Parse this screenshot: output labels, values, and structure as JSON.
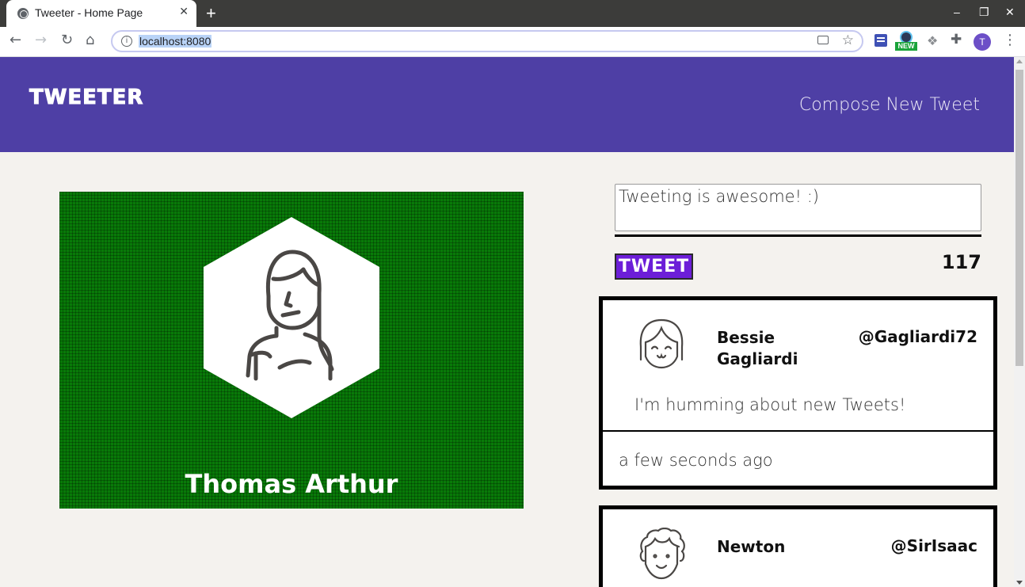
{
  "browser": {
    "tab_title": "Tweeter - Home Page",
    "tab_close": "✕",
    "new_tab": "+",
    "url": "localhost:8080",
    "profile_initial": "T",
    "extension_badge": "NEW",
    "window_controls": {
      "minimize": "–",
      "restore": "❐",
      "close": "✕"
    },
    "nav": {
      "back": "←",
      "forward": "→",
      "reload": "↻",
      "home": "⌂"
    }
  },
  "header": {
    "brand": "TWEETER",
    "compose_link": "Compose New Tweet"
  },
  "profile": {
    "name": "Thomas Arthur",
    "background_color": "#087a08"
  },
  "composer": {
    "text": "Tweeting is awesome! :)",
    "submit_label": "TWEET",
    "char_counter": "117"
  },
  "tweets": [
    {
      "name": "Bessie Gagliardi",
      "handle": "@Gagliardi72",
      "body": "I'm humming about new Tweets!",
      "time": "a few seconds ago",
      "avatar_icon": "girl-avatar-icon"
    },
    {
      "name": "Newton",
      "handle": "@SirIsaac",
      "body": "",
      "time": "",
      "avatar_icon": "curly-hair-avatar-icon"
    }
  ],
  "colors": {
    "nav_bg": "#4e3fa5",
    "tweet_button": "#6c1ed8",
    "page_bg": "#f4f2ee"
  }
}
